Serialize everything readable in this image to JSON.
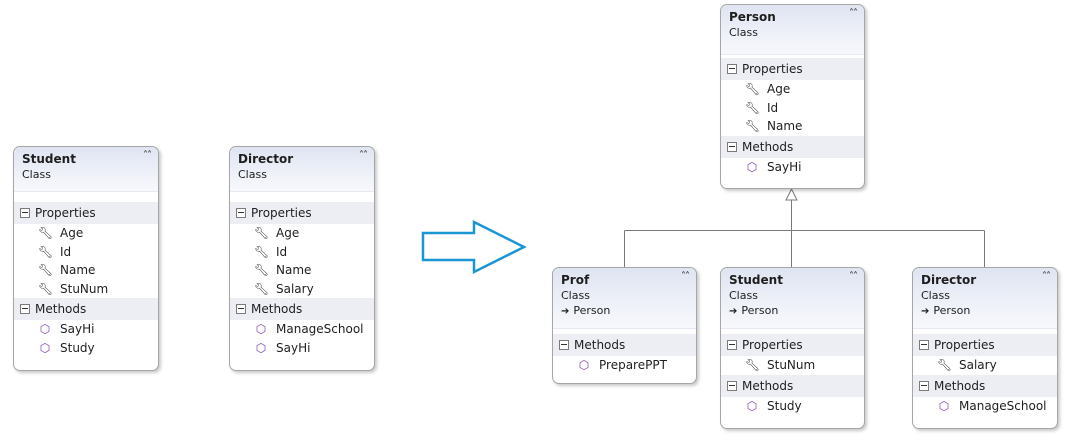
{
  "labels": {
    "properties": "Properties",
    "methods": "Methods",
    "class_kind": "Class",
    "collapse_glyph": "˄˄"
  },
  "icons": {
    "property": "wrench-icon",
    "method": "method-cube-icon",
    "collapse": "double-chevron-up-icon",
    "inheritance": "inheritance-arrow-icon"
  },
  "colors": {
    "arrow_stroke": "#1a96d4",
    "class_border": "#a6a6a6",
    "header_gradient_top": "#dfe4f2",
    "method_icon": "#7b3fb0"
  },
  "before": {
    "student": {
      "name": "Student",
      "kind": "Class",
      "properties": [
        "Age",
        "Id",
        "Name",
        "StuNum"
      ],
      "methods": [
        "SayHi",
        "Study"
      ]
    },
    "director": {
      "name": "Director",
      "kind": "Class",
      "properties": [
        "Age",
        "Id",
        "Name",
        "Salary"
      ],
      "methods": [
        "ManageSchool",
        "SayHi"
      ]
    }
  },
  "after": {
    "person": {
      "name": "Person",
      "kind": "Class",
      "properties": [
        "Age",
        "Id",
        "Name"
      ],
      "methods": [
        "SayHi"
      ]
    },
    "prof": {
      "name": "Prof",
      "kind": "Class",
      "base": "Person",
      "methods": [
        "PreparePPT"
      ]
    },
    "student": {
      "name": "Student",
      "kind": "Class",
      "base": "Person",
      "properties": [
        "StuNum"
      ],
      "methods": [
        "Study"
      ]
    },
    "director": {
      "name": "Director",
      "kind": "Class",
      "base": "Person",
      "properties": [
        "Salary"
      ],
      "methods": [
        "ManageSchool"
      ]
    }
  }
}
